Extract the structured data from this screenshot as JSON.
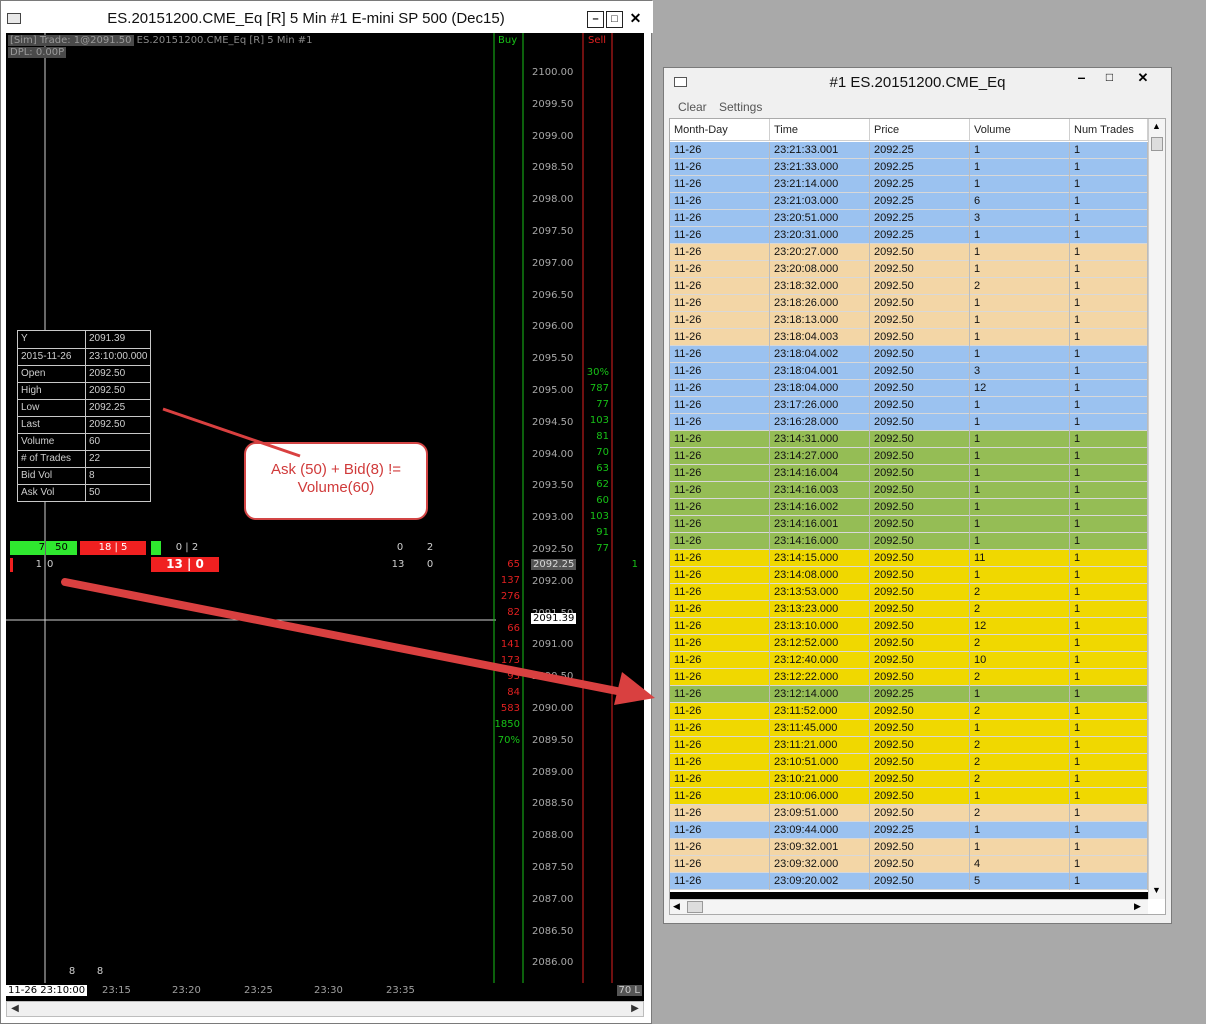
{
  "chart_window": {
    "title": "ES.20151200.CME_Eq [R]  5 Min   #1  E-mini SP 500 (Dec15)",
    "header_line1_boxed": "[Sim]  Trade: 1@2091.50",
    "header_line1_rest": " ES.20151200.CME_Eq [R]  5 Min   #1",
    "header_line2": "DPL: 0.00P",
    "buy_label": "Buy",
    "sell_label": "Sell",
    "price_axis": [
      "2100.00",
      "2099.50",
      "2099.00",
      "2098.50",
      "2098.00",
      "2097.50",
      "2097.00",
      "2096.50",
      "2096.00",
      "2095.50",
      "2095.00",
      "2094.50",
      "2094.00",
      "2093.50",
      "2093.00",
      "2092.50",
      "2092.00",
      "2091.50",
      "2091.00",
      "2090.50",
      "2090.00",
      "2089.50",
      "2089.00",
      "2088.50",
      "2088.00",
      "2087.50",
      "2087.00",
      "2086.50",
      "2086.00"
    ],
    "current_price_marker": "2092.25",
    "cursor_price_marker": "2091.39",
    "buy_pct_top": "30%",
    "green_volumes": [
      "787",
      "77",
      "103",
      "81",
      "70",
      "63",
      "62",
      "60",
      "103",
      "91",
      "77"
    ],
    "red_volumes": [
      "65",
      "137",
      "276",
      "82",
      "66",
      "141",
      "173",
      "93",
      "84",
      "583"
    ],
    "sell_total": "1850",
    "sell_pct": "70%",
    "right_edge_value": "1",
    "data_window": [
      {
        "k": "Y",
        "v": "2091.39"
      },
      {
        "k": "2015-11-26",
        "v": "23:10:00.000"
      },
      {
        "k": "Open",
        "v": "2092.50"
      },
      {
        "k": "High",
        "v": "2092.50"
      },
      {
        "k": "Low",
        "v": "2092.25"
      },
      {
        "k": "Last",
        "v": "2092.50"
      },
      {
        "k": "Volume",
        "v": "60"
      },
      {
        "k": "# of Trades",
        "v": "22"
      },
      {
        "k": "Bid Vol",
        "v": "8"
      },
      {
        "k": "Ask Vol",
        "v": "50"
      }
    ],
    "callout_text": "Ask (50) + Bid(8) != Volume(60)",
    "bar_labels": {
      "green_a": "7",
      "green_b": "50",
      "red_a": "18 | 5",
      "gray_pair": "0 | 2",
      "red_bold": "13 | 0",
      "row2_a": "1",
      "row2_b": "0",
      "right_pair_top_a": "0",
      "right_pair_top_b": "2",
      "right_pair_bot_a": "13",
      "right_pair_bot_b": "0"
    },
    "bottom_counts": [
      "8",
      "8"
    ],
    "time_axis": [
      "11-26  23:10:00",
      "23:15",
      "23:20",
      "23:25",
      "23:30",
      "23:35"
    ],
    "time_axis_right": "70 L"
  },
  "ts_window": {
    "title": "#1 ES.20151200.CME_Eq",
    "menu": [
      "Clear",
      "Settings"
    ],
    "columns": [
      "Month-Day",
      "Time",
      "Price",
      "Volume",
      "Num Trades"
    ],
    "colors": {
      "blue": "#9bc2f0",
      "tan": "#f3d6a6",
      "green": "#95bd55",
      "yellow": "#f0d800"
    },
    "rows": [
      {
        "d": "11-26",
        "t": "23:21:33.001",
        "p": "2092.25",
        "v": "1",
        "n": "1",
        "c": "blue"
      },
      {
        "d": "11-26",
        "t": "23:21:33.000",
        "p": "2092.25",
        "v": "1",
        "n": "1",
        "c": "blue"
      },
      {
        "d": "11-26",
        "t": "23:21:14.000",
        "p": "2092.25",
        "v": "1",
        "n": "1",
        "c": "blue"
      },
      {
        "d": "11-26",
        "t": "23:21:03.000",
        "p": "2092.25",
        "v": "6",
        "n": "1",
        "c": "blue"
      },
      {
        "d": "11-26",
        "t": "23:20:51.000",
        "p": "2092.25",
        "v": "3",
        "n": "1",
        "c": "blue"
      },
      {
        "d": "11-26",
        "t": "23:20:31.000",
        "p": "2092.25",
        "v": "1",
        "n": "1",
        "c": "blue"
      },
      {
        "d": "11-26",
        "t": "23:20:27.000",
        "p": "2092.50",
        "v": "1",
        "n": "1",
        "c": "tan"
      },
      {
        "d": "11-26",
        "t": "23:20:08.000",
        "p": "2092.50",
        "v": "1",
        "n": "1",
        "c": "tan"
      },
      {
        "d": "11-26",
        "t": "23:18:32.000",
        "p": "2092.50",
        "v": "2",
        "n": "1",
        "c": "tan"
      },
      {
        "d": "11-26",
        "t": "23:18:26.000",
        "p": "2092.50",
        "v": "1",
        "n": "1",
        "c": "tan"
      },
      {
        "d": "11-26",
        "t": "23:18:13.000",
        "p": "2092.50",
        "v": "1",
        "n": "1",
        "c": "tan"
      },
      {
        "d": "11-26",
        "t": "23:18:04.003",
        "p": "2092.50",
        "v": "1",
        "n": "1",
        "c": "tan"
      },
      {
        "d": "11-26",
        "t": "23:18:04.002",
        "p": "2092.50",
        "v": "1",
        "n": "1",
        "c": "blue"
      },
      {
        "d": "11-26",
        "t": "23:18:04.001",
        "p": "2092.50",
        "v": "3",
        "n": "1",
        "c": "blue"
      },
      {
        "d": "11-26",
        "t": "23:18:04.000",
        "p": "2092.50",
        "v": "12",
        "n": "1",
        "c": "blue"
      },
      {
        "d": "11-26",
        "t": "23:17:26.000",
        "p": "2092.50",
        "v": "1",
        "n": "1",
        "c": "blue"
      },
      {
        "d": "11-26",
        "t": "23:16:28.000",
        "p": "2092.50",
        "v": "1",
        "n": "1",
        "c": "blue"
      },
      {
        "d": "11-26",
        "t": "23:14:31.000",
        "p": "2092.50",
        "v": "1",
        "n": "1",
        "c": "green"
      },
      {
        "d": "11-26",
        "t": "23:14:27.000",
        "p": "2092.50",
        "v": "1",
        "n": "1",
        "c": "green"
      },
      {
        "d": "11-26",
        "t": "23:14:16.004",
        "p": "2092.50",
        "v": "1",
        "n": "1",
        "c": "green"
      },
      {
        "d": "11-26",
        "t": "23:14:16.003",
        "p": "2092.50",
        "v": "1",
        "n": "1",
        "c": "green"
      },
      {
        "d": "11-26",
        "t": "23:14:16.002",
        "p": "2092.50",
        "v": "1",
        "n": "1",
        "c": "green"
      },
      {
        "d": "11-26",
        "t": "23:14:16.001",
        "p": "2092.50",
        "v": "1",
        "n": "1",
        "c": "green"
      },
      {
        "d": "11-26",
        "t": "23:14:16.000",
        "p": "2092.50",
        "v": "1",
        "n": "1",
        "c": "green"
      },
      {
        "d": "11-26",
        "t": "23:14:15.000",
        "p": "2092.50",
        "v": "11",
        "n": "1",
        "c": "yellow"
      },
      {
        "d": "11-26",
        "t": "23:14:08.000",
        "p": "2092.50",
        "v": "1",
        "n": "1",
        "c": "yellow"
      },
      {
        "d": "11-26",
        "t": "23:13:53.000",
        "p": "2092.50",
        "v": "2",
        "n": "1",
        "c": "yellow"
      },
      {
        "d": "11-26",
        "t": "23:13:23.000",
        "p": "2092.50",
        "v": "2",
        "n": "1",
        "c": "yellow"
      },
      {
        "d": "11-26",
        "t": "23:13:10.000",
        "p": "2092.50",
        "v": "12",
        "n": "1",
        "c": "yellow"
      },
      {
        "d": "11-26",
        "t": "23:12:52.000",
        "p": "2092.50",
        "v": "2",
        "n": "1",
        "c": "yellow"
      },
      {
        "d": "11-26",
        "t": "23:12:40.000",
        "p": "2092.50",
        "v": "10",
        "n": "1",
        "c": "yellow"
      },
      {
        "d": "11-26",
        "t": "23:12:22.000",
        "p": "2092.50",
        "v": "2",
        "n": "1",
        "c": "yellow"
      },
      {
        "d": "11-26",
        "t": "23:12:14.000",
        "p": "2092.25",
        "v": "1",
        "n": "1",
        "c": "green"
      },
      {
        "d": "11-26",
        "t": "23:11:52.000",
        "p": "2092.50",
        "v": "2",
        "n": "1",
        "c": "yellow"
      },
      {
        "d": "11-26",
        "t": "23:11:45.000",
        "p": "2092.50",
        "v": "1",
        "n": "1",
        "c": "yellow"
      },
      {
        "d": "11-26",
        "t": "23:11:21.000",
        "p": "2092.50",
        "v": "2",
        "n": "1",
        "c": "yellow"
      },
      {
        "d": "11-26",
        "t": "23:10:51.000",
        "p": "2092.50",
        "v": "2",
        "n": "1",
        "c": "yellow"
      },
      {
        "d": "11-26",
        "t": "23:10:21.000",
        "p": "2092.50",
        "v": "2",
        "n": "1",
        "c": "yellow"
      },
      {
        "d": "11-26",
        "t": "23:10:06.000",
        "p": "2092.50",
        "v": "1",
        "n": "1",
        "c": "yellow"
      },
      {
        "d": "11-26",
        "t": "23:09:51.000",
        "p": "2092.50",
        "v": "2",
        "n": "1",
        "c": "tan"
      },
      {
        "d": "11-26",
        "t": "23:09:44.000",
        "p": "2092.25",
        "v": "1",
        "n": "1",
        "c": "blue"
      },
      {
        "d": "11-26",
        "t": "23:09:32.001",
        "p": "2092.50",
        "v": "1",
        "n": "1",
        "c": "tan"
      },
      {
        "d": "11-26",
        "t": "23:09:32.000",
        "p": "2092.50",
        "v": "4",
        "n": "1",
        "c": "tan"
      },
      {
        "d": "11-26",
        "t": "23:09:20.002",
        "p": "2092.50",
        "v": "5",
        "n": "1",
        "c": "blue"
      }
    ]
  }
}
